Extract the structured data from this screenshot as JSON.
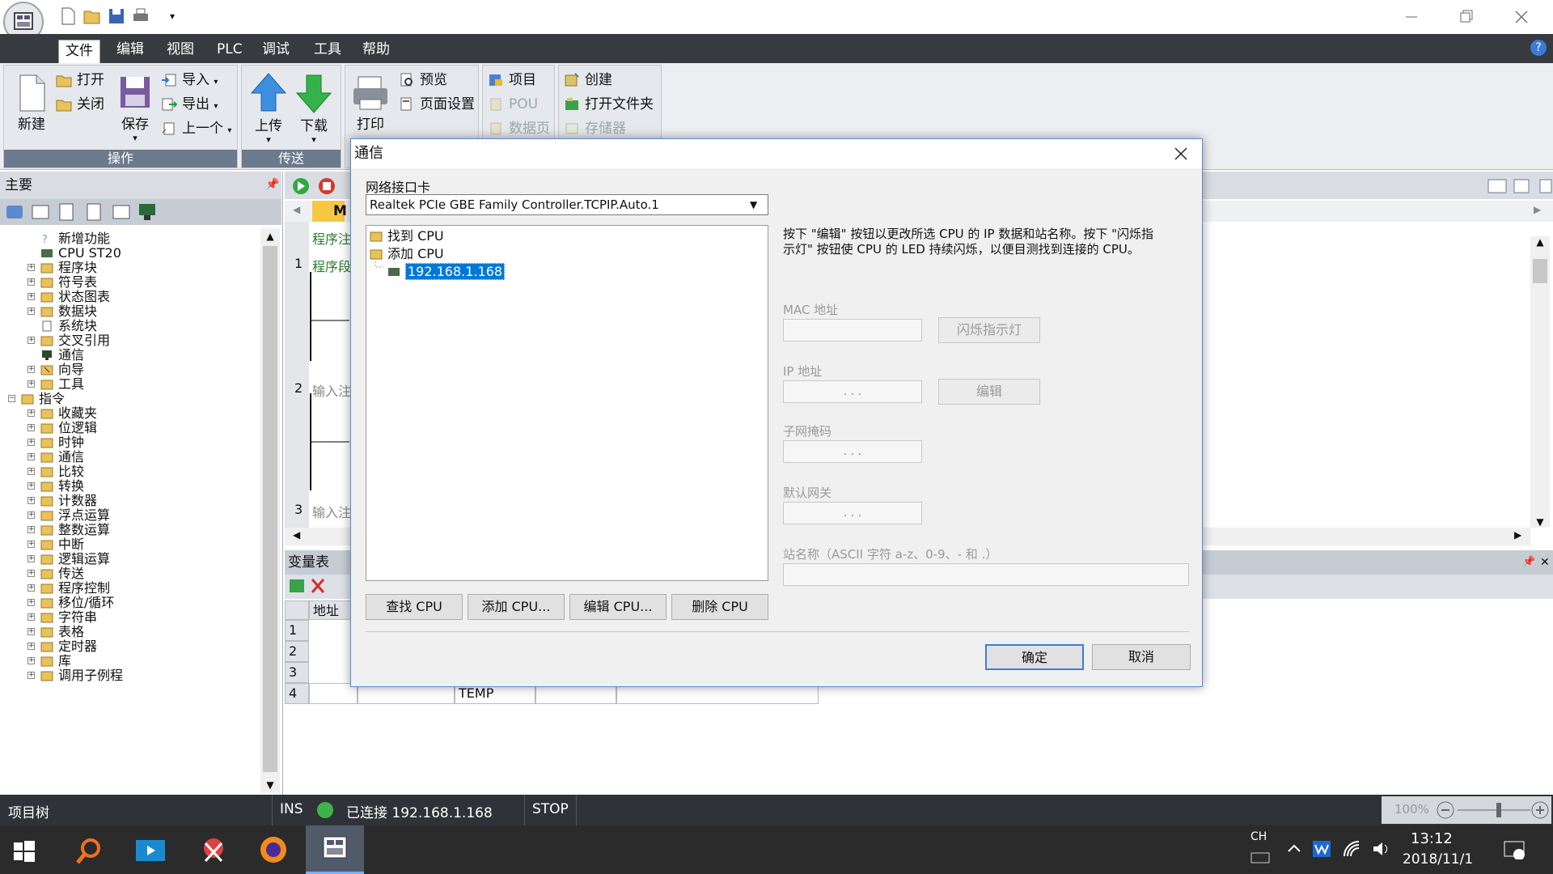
{
  "app": {
    "qat": [
      "new-icon",
      "open-icon",
      "save-icon",
      "print-icon"
    ],
    "help_label": "?"
  },
  "menu": [
    "文件",
    "编辑",
    "视图",
    "PLC",
    "调试",
    "工具",
    "帮助"
  ],
  "ribbon": {
    "new_label": "新建",
    "open_label": "打开",
    "close_label": "关闭",
    "save_label": "保存",
    "import_label": "导入",
    "export_label": "导出",
    "previous_label": "上一个",
    "group_ops": "操作",
    "upload_label": "上传",
    "download_label": "下载",
    "group_transfer": "传送",
    "print_label": "打印",
    "preview_label": "预览",
    "page_setup_label": "页面设置",
    "project_label": "项目",
    "pou_label": "POU",
    "datapage_label": "数据页",
    "create_label": "创建",
    "open_folder_label": "打开文件夹",
    "memory_label": "存储器"
  },
  "leftpane": {
    "title": "主要",
    "project_items": [
      "新增功能",
      "CPU ST20",
      "程序块",
      "符号表",
      "状态图表",
      "数据块",
      "系统块",
      "交叉引用",
      "通信",
      "向导",
      "工具"
    ],
    "instructions_label": "指令",
    "instruction_items": [
      "收藏夹",
      "位逻辑",
      "时钟",
      "通信",
      "比较",
      "转换",
      "计数器",
      "浮点运算",
      "整数运算",
      "中断",
      "逻辑运算",
      "传送",
      "程序控制",
      "移位/循环",
      "字符串",
      "表格",
      "定时器",
      "库",
      "调用子例程"
    ]
  },
  "editor": {
    "tab_label": "M",
    "comment_hint": "程序注",
    "rungs": [
      {
        "num": "1",
        "text": "程序段"
      },
      {
        "num": "2",
        "text": "输入注"
      },
      {
        "num": "3",
        "text": "输入注"
      }
    ]
  },
  "varpane": {
    "title": "变量表",
    "header_addr": "地址",
    "rows": [
      "1",
      "2",
      "3",
      "4"
    ],
    "row4_type": "TEMP"
  },
  "dialog": {
    "title": "通信",
    "nic_label": "网络接口卡",
    "nic_value": "Realtek PCIe GBE Family Controller.TCPIP.Auto.1",
    "tree_found": "找到 CPU",
    "tree_added": "添加 CPU",
    "tree_ip": "192.168.1.168",
    "info_line1": "按下 \"编辑\" 按钮以更改所选 CPU 的 IP 数据和站名称。按下 \"闪烁指",
    "info_line2": "示灯\" 按钮使 CPU 的 LED 持续闪烁，以便目测找到连接的 CPU。",
    "mac_label": "MAC 地址",
    "blink_label": "闪烁指示灯",
    "ip_label": "IP 地址",
    "edit_label": "编辑",
    "subnet_label": "子网掩码",
    "gateway_label": "默认网关",
    "station_label": "站名称（ASCII 字符 a-z、0-9、- 和 .）",
    "find_btn": "查找 CPU",
    "add_btn": "添加 CPU...",
    "edit_btn": "编辑 CPU...",
    "delete_btn": "删除 CPU",
    "ok_btn": "确定",
    "cancel_btn": "取消",
    "ip_dots": ".        .        ."
  },
  "status": {
    "tree_label": "项目树",
    "ins": "INS",
    "connected": "已连接 192.168.1.168",
    "mode": "STOP",
    "zoom": "100%"
  },
  "taskbar": {
    "lang": "CH",
    "time": "13:12",
    "date": "2018/11/1"
  },
  "colors": {
    "menubar": "#373a3f",
    "status_green": "#3cb44b",
    "selection": "#0078d7"
  }
}
